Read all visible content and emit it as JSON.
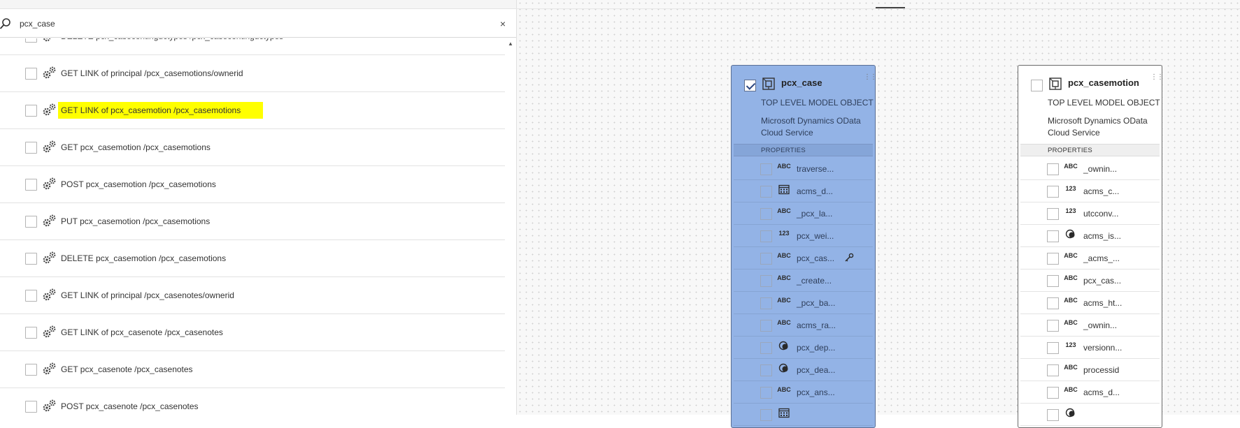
{
  "search": {
    "value": "pcx_case",
    "clear_label": "×"
  },
  "list": {
    "scroll_up_label": "▲",
    "items": [
      {
        "label": "DELETE pcx_casecontinguctypes /pcx_casecontinguctypes",
        "checked": false,
        "highlighted": false
      },
      {
        "label": "GET LINK of principal /pcx_casemotions/ownerid",
        "checked": false,
        "highlighted": false
      },
      {
        "label": "GET LINK of pcx_casemotion /pcx_casemotions",
        "checked": false,
        "highlighted": true
      },
      {
        "label": "GET pcx_casemotion /pcx_casemotions",
        "checked": false,
        "highlighted": false
      },
      {
        "label": "POST pcx_casemotion /pcx_casemotions",
        "checked": false,
        "highlighted": false
      },
      {
        "label": "PUT pcx_casemotion /pcx_casemotions",
        "checked": false,
        "highlighted": false
      },
      {
        "label": "DELETE pcx_casemotion /pcx_casemotions",
        "checked": false,
        "highlighted": false
      },
      {
        "label": "GET LINK of principal /pcx_casenotes/ownerid",
        "checked": false,
        "highlighted": false
      },
      {
        "label": "GET LINK of pcx_casenote /pcx_casenotes",
        "checked": false,
        "highlighted": false
      },
      {
        "label": "GET pcx_casenote /pcx_casenotes",
        "checked": false,
        "highlighted": false
      },
      {
        "label": "POST pcx_casenote /pcx_casenotes",
        "checked": false,
        "highlighted": false
      }
    ]
  },
  "cards": [
    {
      "title": "pcx_case",
      "checked": true,
      "subtitle": "TOP LEVEL MODEL OBJECT",
      "source_line1": "Microsoft Dynamics OData",
      "source_line2": "Cloud Service",
      "properties_header": "PROPERTIES",
      "properties": [
        {
          "type": "ABC",
          "name": "traverse..."
        },
        {
          "type": "calendar",
          "name": "acms_d..."
        },
        {
          "type": "ABC",
          "name": "_pcx_la..."
        },
        {
          "type": "123",
          "name": "pcx_wei..."
        },
        {
          "type": "ABC",
          "name": "pcx_cas...",
          "key": true
        },
        {
          "type": "ABC",
          "name": "_create..."
        },
        {
          "type": "ABC",
          "name": "_pcx_ba..."
        },
        {
          "type": "ABC",
          "name": "acms_ra..."
        },
        {
          "type": "choice",
          "name": "pcx_dep..."
        },
        {
          "type": "choice",
          "name": "pcx_dea..."
        },
        {
          "type": "ABC",
          "name": "pcx_ans..."
        },
        {
          "type": "calendar",
          "name": ""
        }
      ]
    },
    {
      "title": "pcx_casemotion",
      "checked": false,
      "subtitle": "TOP LEVEL MODEL OBJECT",
      "source_line1": "Microsoft Dynamics OData",
      "source_line2": "Cloud Service",
      "properties_header": "PROPERTIES",
      "properties": [
        {
          "type": "ABC",
          "name": "_ownin..."
        },
        {
          "type": "123",
          "name": "acms_c..."
        },
        {
          "type": "123",
          "name": "utcconv..."
        },
        {
          "type": "choice",
          "name": "acms_is..."
        },
        {
          "type": "ABC",
          "name": "_acms_..."
        },
        {
          "type": "ABC",
          "name": "pcx_cas..."
        },
        {
          "type": "ABC",
          "name": "acms_ht..."
        },
        {
          "type": "ABC",
          "name": "_ownin..."
        },
        {
          "type": "123",
          "name": "versionn..."
        },
        {
          "type": "ABC",
          "name": "processid"
        },
        {
          "type": "ABC",
          "name": "acms_d..."
        },
        {
          "type": "choice",
          "name": ""
        }
      ]
    }
  ],
  "colors": {
    "highlight": "#ffff00",
    "selected_card": "#93b3e6",
    "canvas": "#f8f8f8"
  }
}
